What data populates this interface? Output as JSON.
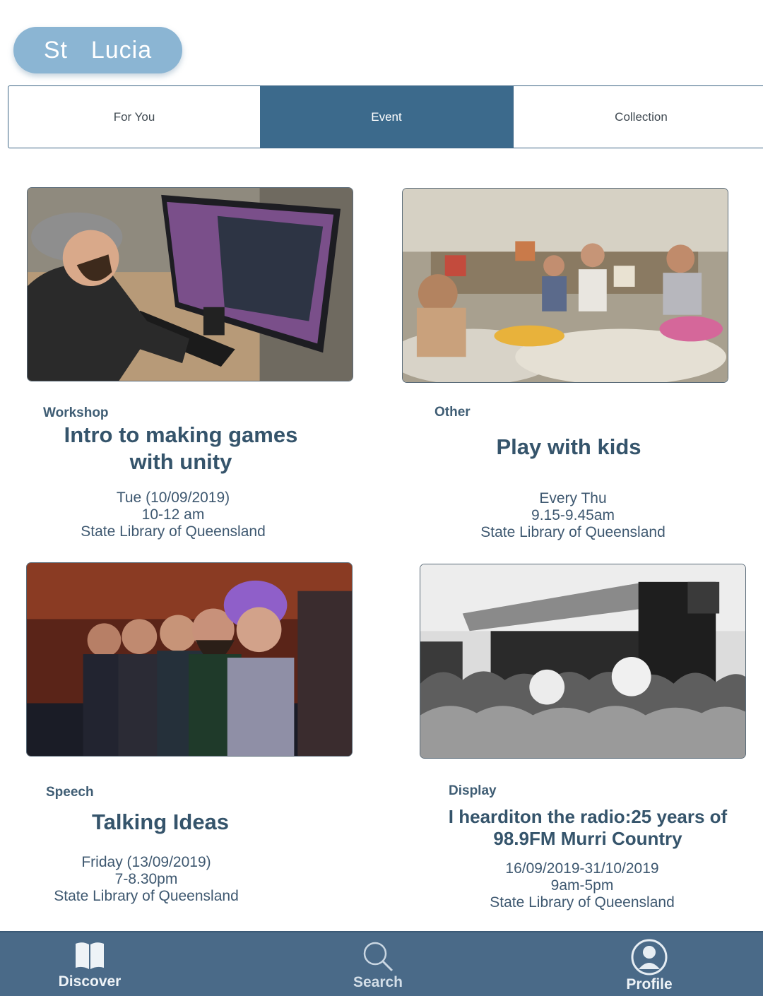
{
  "location": {
    "label": "St  Lucia"
  },
  "tabs": [
    {
      "label": "For You",
      "active": false
    },
    {
      "label": "Event",
      "active": true
    },
    {
      "label": "Collection",
      "active": false
    }
  ],
  "events": [
    {
      "image": "person-coding-at-computer",
      "category": "Workshop",
      "title_line1": "Intro to making games",
      "title_line2": "with unity",
      "date": "Tue (10/09/2019)",
      "time": "10-12 am",
      "venue": "State Library of Queensland"
    },
    {
      "image": "families-playing-with-kids",
      "category": "Other",
      "title_line1": "Play with kids",
      "date": "Every Thu",
      "time": "9.15-9.45am",
      "venue": "State Library of Queensland"
    },
    {
      "image": "audience-listening",
      "category": "Speech",
      "title_line1": "Talking Ideas",
      "date": "Friday (13/09/2019)",
      "time": "7-8.30pm",
      "venue": "State Library of Queensland"
    },
    {
      "image": "crowd-at-outdoor-concert",
      "category": "Display",
      "title_line1": "I hearditon the radio:25 years of",
      "title_line2": "98.9FM Murri Country",
      "date": "16/09/2019-31/10/2019",
      "time": "9am-5pm",
      "venue": "State Library of Queensland"
    }
  ],
  "bottom_nav": [
    {
      "label": "Discover",
      "icon": "book-icon"
    },
    {
      "label": "Search",
      "icon": "search-icon"
    },
    {
      "label": "Profile",
      "icon": "profile-icon"
    }
  ],
  "colors": {
    "accent": "#3c6a8c",
    "pill": "#8bb5d3",
    "nav_bar": "#4a6a88",
    "text": "#3a5468"
  }
}
